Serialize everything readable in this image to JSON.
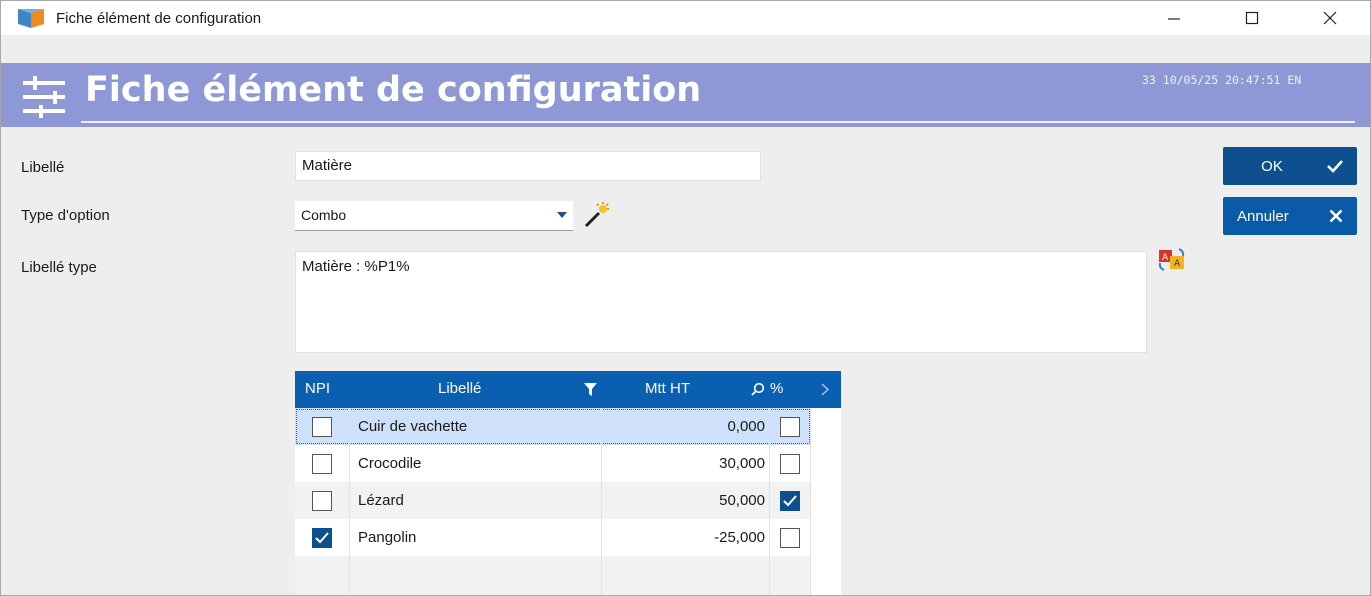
{
  "window": {
    "title": "Fiche élément de configuration",
    "controls": {
      "minimize": "minimize-icon",
      "maximize": "maximize-icon",
      "close": "close-icon"
    }
  },
  "header": {
    "title": "Fiche élément de configuration",
    "status": "33  10/05/25 20:47:51  EN",
    "icon": "settings-sliders-icon",
    "background_color": "#8f98d7"
  },
  "form": {
    "libelle": {
      "label": "Libellé",
      "value": "Matière"
    },
    "type_option": {
      "label": "Type d'option",
      "value": "Combo"
    },
    "libelle_type": {
      "label": "Libellé type",
      "value": "Matière : %P1%"
    }
  },
  "buttons": {
    "ok": "OK",
    "cancel": "Annuler",
    "accent_color": "#0a5aa8"
  },
  "grid": {
    "columns": {
      "npi": "NPI",
      "libelle": "Libellé",
      "mtt": "Mtt HT",
      "pct": "%"
    },
    "header_color": "#0b5fb0",
    "rows": [
      {
        "npi": false,
        "libelle": "Cuir de vachette",
        "mtt": "0,000",
        "pct": false
      },
      {
        "npi": false,
        "libelle": "Crocodile",
        "mtt": "30,000",
        "pct": false
      },
      {
        "npi": false,
        "libelle": "Lézard",
        "mtt": "50,000",
        "pct": true
      },
      {
        "npi": true,
        "libelle": "Pangolin",
        "mtt": "-25,000",
        "pct": false
      }
    ]
  }
}
